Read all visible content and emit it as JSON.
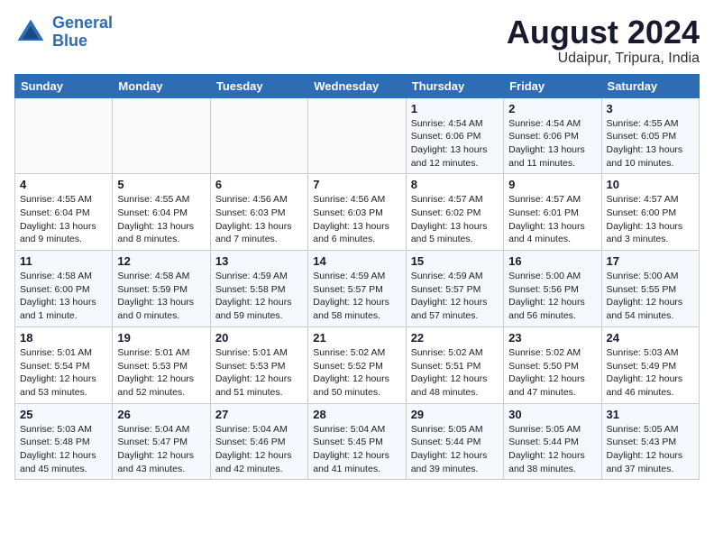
{
  "header": {
    "logo_line1": "General",
    "logo_line2": "Blue",
    "title": "August 2024",
    "subtitle": "Udaipur, Tripura, India"
  },
  "days_of_week": [
    "Sunday",
    "Monday",
    "Tuesday",
    "Wednesday",
    "Thursday",
    "Friday",
    "Saturday"
  ],
  "weeks": [
    [
      {
        "day": "",
        "info": ""
      },
      {
        "day": "",
        "info": ""
      },
      {
        "day": "",
        "info": ""
      },
      {
        "day": "",
        "info": ""
      },
      {
        "day": "1",
        "info": "Sunrise: 4:54 AM\nSunset: 6:06 PM\nDaylight: 13 hours and 12 minutes."
      },
      {
        "day": "2",
        "info": "Sunrise: 4:54 AM\nSunset: 6:06 PM\nDaylight: 13 hours and 11 minutes."
      },
      {
        "day": "3",
        "info": "Sunrise: 4:55 AM\nSunset: 6:05 PM\nDaylight: 13 hours and 10 minutes."
      }
    ],
    [
      {
        "day": "4",
        "info": "Sunrise: 4:55 AM\nSunset: 6:04 PM\nDaylight: 13 hours and 9 minutes."
      },
      {
        "day": "5",
        "info": "Sunrise: 4:55 AM\nSunset: 6:04 PM\nDaylight: 13 hours and 8 minutes."
      },
      {
        "day": "6",
        "info": "Sunrise: 4:56 AM\nSunset: 6:03 PM\nDaylight: 13 hours and 7 minutes."
      },
      {
        "day": "7",
        "info": "Sunrise: 4:56 AM\nSunset: 6:03 PM\nDaylight: 13 hours and 6 minutes."
      },
      {
        "day": "8",
        "info": "Sunrise: 4:57 AM\nSunset: 6:02 PM\nDaylight: 13 hours and 5 minutes."
      },
      {
        "day": "9",
        "info": "Sunrise: 4:57 AM\nSunset: 6:01 PM\nDaylight: 13 hours and 4 minutes."
      },
      {
        "day": "10",
        "info": "Sunrise: 4:57 AM\nSunset: 6:00 PM\nDaylight: 13 hours and 3 minutes."
      }
    ],
    [
      {
        "day": "11",
        "info": "Sunrise: 4:58 AM\nSunset: 6:00 PM\nDaylight: 13 hours and 1 minute."
      },
      {
        "day": "12",
        "info": "Sunrise: 4:58 AM\nSunset: 5:59 PM\nDaylight: 13 hours and 0 minutes."
      },
      {
        "day": "13",
        "info": "Sunrise: 4:59 AM\nSunset: 5:58 PM\nDaylight: 12 hours and 59 minutes."
      },
      {
        "day": "14",
        "info": "Sunrise: 4:59 AM\nSunset: 5:57 PM\nDaylight: 12 hours and 58 minutes."
      },
      {
        "day": "15",
        "info": "Sunrise: 4:59 AM\nSunset: 5:57 PM\nDaylight: 12 hours and 57 minutes."
      },
      {
        "day": "16",
        "info": "Sunrise: 5:00 AM\nSunset: 5:56 PM\nDaylight: 12 hours and 56 minutes."
      },
      {
        "day": "17",
        "info": "Sunrise: 5:00 AM\nSunset: 5:55 PM\nDaylight: 12 hours and 54 minutes."
      }
    ],
    [
      {
        "day": "18",
        "info": "Sunrise: 5:01 AM\nSunset: 5:54 PM\nDaylight: 12 hours and 53 minutes."
      },
      {
        "day": "19",
        "info": "Sunrise: 5:01 AM\nSunset: 5:53 PM\nDaylight: 12 hours and 52 minutes."
      },
      {
        "day": "20",
        "info": "Sunrise: 5:01 AM\nSunset: 5:53 PM\nDaylight: 12 hours and 51 minutes."
      },
      {
        "day": "21",
        "info": "Sunrise: 5:02 AM\nSunset: 5:52 PM\nDaylight: 12 hours and 50 minutes."
      },
      {
        "day": "22",
        "info": "Sunrise: 5:02 AM\nSunset: 5:51 PM\nDaylight: 12 hours and 48 minutes."
      },
      {
        "day": "23",
        "info": "Sunrise: 5:02 AM\nSunset: 5:50 PM\nDaylight: 12 hours and 47 minutes."
      },
      {
        "day": "24",
        "info": "Sunrise: 5:03 AM\nSunset: 5:49 PM\nDaylight: 12 hours and 46 minutes."
      }
    ],
    [
      {
        "day": "25",
        "info": "Sunrise: 5:03 AM\nSunset: 5:48 PM\nDaylight: 12 hours and 45 minutes."
      },
      {
        "day": "26",
        "info": "Sunrise: 5:04 AM\nSunset: 5:47 PM\nDaylight: 12 hours and 43 minutes."
      },
      {
        "day": "27",
        "info": "Sunrise: 5:04 AM\nSunset: 5:46 PM\nDaylight: 12 hours and 42 minutes."
      },
      {
        "day": "28",
        "info": "Sunrise: 5:04 AM\nSunset: 5:45 PM\nDaylight: 12 hours and 41 minutes."
      },
      {
        "day": "29",
        "info": "Sunrise: 5:05 AM\nSunset: 5:44 PM\nDaylight: 12 hours and 39 minutes."
      },
      {
        "day": "30",
        "info": "Sunrise: 5:05 AM\nSunset: 5:44 PM\nDaylight: 12 hours and 38 minutes."
      },
      {
        "day": "31",
        "info": "Sunrise: 5:05 AM\nSunset: 5:43 PM\nDaylight: 12 hours and 37 minutes."
      }
    ]
  ]
}
